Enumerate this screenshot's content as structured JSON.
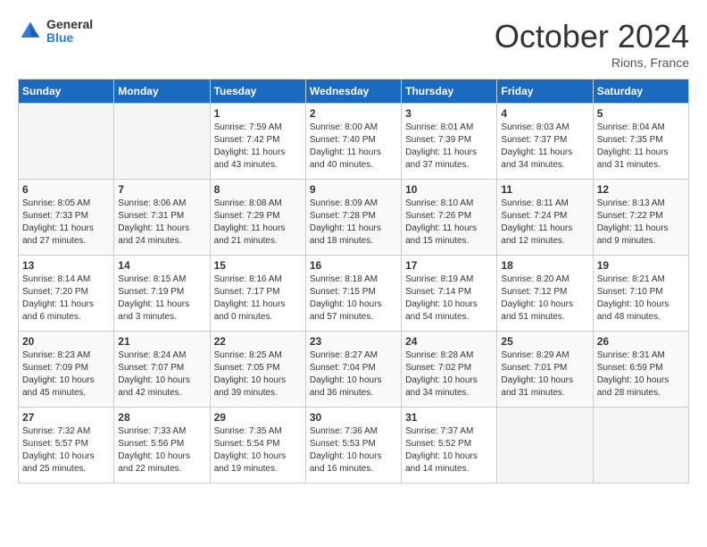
{
  "header": {
    "logo_general": "General",
    "logo_blue": "Blue",
    "month_title": "October 2024",
    "location": "Rions, France"
  },
  "days_of_week": [
    "Sunday",
    "Monday",
    "Tuesday",
    "Wednesday",
    "Thursday",
    "Friday",
    "Saturday"
  ],
  "weeks": [
    [
      {
        "day": null,
        "empty": true
      },
      {
        "day": null,
        "empty": true
      },
      {
        "day": 1,
        "sunrise": "Sunrise: 7:59 AM",
        "sunset": "Sunset: 7:42 PM",
        "daylight": "Daylight: 11 hours and 43 minutes."
      },
      {
        "day": 2,
        "sunrise": "Sunrise: 8:00 AM",
        "sunset": "Sunset: 7:40 PM",
        "daylight": "Daylight: 11 hours and 40 minutes."
      },
      {
        "day": 3,
        "sunrise": "Sunrise: 8:01 AM",
        "sunset": "Sunset: 7:39 PM",
        "daylight": "Daylight: 11 hours and 37 minutes."
      },
      {
        "day": 4,
        "sunrise": "Sunrise: 8:03 AM",
        "sunset": "Sunset: 7:37 PM",
        "daylight": "Daylight: 11 hours and 34 minutes."
      },
      {
        "day": 5,
        "sunrise": "Sunrise: 8:04 AM",
        "sunset": "Sunset: 7:35 PM",
        "daylight": "Daylight: 11 hours and 31 minutes."
      }
    ],
    [
      {
        "day": 6,
        "sunrise": "Sunrise: 8:05 AM",
        "sunset": "Sunset: 7:33 PM",
        "daylight": "Daylight: 11 hours and 27 minutes."
      },
      {
        "day": 7,
        "sunrise": "Sunrise: 8:06 AM",
        "sunset": "Sunset: 7:31 PM",
        "daylight": "Daylight: 11 hours and 24 minutes."
      },
      {
        "day": 8,
        "sunrise": "Sunrise: 8:08 AM",
        "sunset": "Sunset: 7:29 PM",
        "daylight": "Daylight: 11 hours and 21 minutes."
      },
      {
        "day": 9,
        "sunrise": "Sunrise: 8:09 AM",
        "sunset": "Sunset: 7:28 PM",
        "daylight": "Daylight: 11 hours and 18 minutes."
      },
      {
        "day": 10,
        "sunrise": "Sunrise: 8:10 AM",
        "sunset": "Sunset: 7:26 PM",
        "daylight": "Daylight: 11 hours and 15 minutes."
      },
      {
        "day": 11,
        "sunrise": "Sunrise: 8:11 AM",
        "sunset": "Sunset: 7:24 PM",
        "daylight": "Daylight: 11 hours and 12 minutes."
      },
      {
        "day": 12,
        "sunrise": "Sunrise: 8:13 AM",
        "sunset": "Sunset: 7:22 PM",
        "daylight": "Daylight: 11 hours and 9 minutes."
      }
    ],
    [
      {
        "day": 13,
        "sunrise": "Sunrise: 8:14 AM",
        "sunset": "Sunset: 7:20 PM",
        "daylight": "Daylight: 11 hours and 6 minutes."
      },
      {
        "day": 14,
        "sunrise": "Sunrise: 8:15 AM",
        "sunset": "Sunset: 7:19 PM",
        "daylight": "Daylight: 11 hours and 3 minutes."
      },
      {
        "day": 15,
        "sunrise": "Sunrise: 8:16 AM",
        "sunset": "Sunset: 7:17 PM",
        "daylight": "Daylight: 11 hours and 0 minutes."
      },
      {
        "day": 16,
        "sunrise": "Sunrise: 8:18 AM",
        "sunset": "Sunset: 7:15 PM",
        "daylight": "Daylight: 10 hours and 57 minutes."
      },
      {
        "day": 17,
        "sunrise": "Sunrise: 8:19 AM",
        "sunset": "Sunset: 7:14 PM",
        "daylight": "Daylight: 10 hours and 54 minutes."
      },
      {
        "day": 18,
        "sunrise": "Sunrise: 8:20 AM",
        "sunset": "Sunset: 7:12 PM",
        "daylight": "Daylight: 10 hours and 51 minutes."
      },
      {
        "day": 19,
        "sunrise": "Sunrise: 8:21 AM",
        "sunset": "Sunset: 7:10 PM",
        "daylight": "Daylight: 10 hours and 48 minutes."
      }
    ],
    [
      {
        "day": 20,
        "sunrise": "Sunrise: 8:23 AM",
        "sunset": "Sunset: 7:09 PM",
        "daylight": "Daylight: 10 hours and 45 minutes."
      },
      {
        "day": 21,
        "sunrise": "Sunrise: 8:24 AM",
        "sunset": "Sunset: 7:07 PM",
        "daylight": "Daylight: 10 hours and 42 minutes."
      },
      {
        "day": 22,
        "sunrise": "Sunrise: 8:25 AM",
        "sunset": "Sunset: 7:05 PM",
        "daylight": "Daylight: 10 hours and 39 minutes."
      },
      {
        "day": 23,
        "sunrise": "Sunrise: 8:27 AM",
        "sunset": "Sunset: 7:04 PM",
        "daylight": "Daylight: 10 hours and 36 minutes."
      },
      {
        "day": 24,
        "sunrise": "Sunrise: 8:28 AM",
        "sunset": "Sunset: 7:02 PM",
        "daylight": "Daylight: 10 hours and 34 minutes."
      },
      {
        "day": 25,
        "sunrise": "Sunrise: 8:29 AM",
        "sunset": "Sunset: 7:01 PM",
        "daylight": "Daylight: 10 hours and 31 minutes."
      },
      {
        "day": 26,
        "sunrise": "Sunrise: 8:31 AM",
        "sunset": "Sunset: 6:59 PM",
        "daylight": "Daylight: 10 hours and 28 minutes."
      }
    ],
    [
      {
        "day": 27,
        "sunrise": "Sunrise: 7:32 AM",
        "sunset": "Sunset: 5:57 PM",
        "daylight": "Daylight: 10 hours and 25 minutes."
      },
      {
        "day": 28,
        "sunrise": "Sunrise: 7:33 AM",
        "sunset": "Sunset: 5:56 PM",
        "daylight": "Daylight: 10 hours and 22 minutes."
      },
      {
        "day": 29,
        "sunrise": "Sunrise: 7:35 AM",
        "sunset": "Sunset: 5:54 PM",
        "daylight": "Daylight: 10 hours and 19 minutes."
      },
      {
        "day": 30,
        "sunrise": "Sunrise: 7:36 AM",
        "sunset": "Sunset: 5:53 PM",
        "daylight": "Daylight: 10 hours and 16 minutes."
      },
      {
        "day": 31,
        "sunrise": "Sunrise: 7:37 AM",
        "sunset": "Sunset: 5:52 PM",
        "daylight": "Daylight: 10 hours and 14 minutes."
      },
      {
        "day": null,
        "empty": true
      },
      {
        "day": null,
        "empty": true
      }
    ]
  ]
}
